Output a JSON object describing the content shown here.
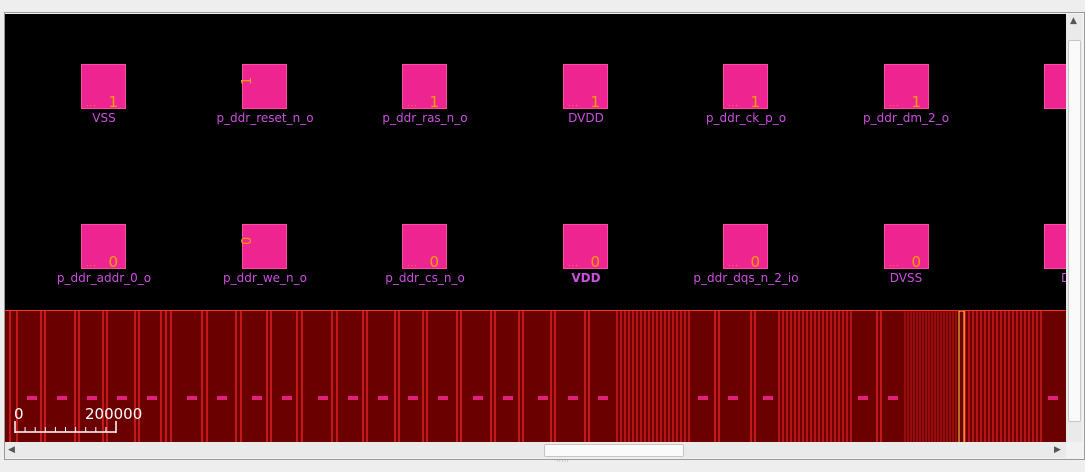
{
  "colors": {
    "background": "#000000",
    "pad_fill": "#ee2590",
    "pad_text": "#f4a000",
    "label_text": "#cc4fe0",
    "rail_fill": "#6b0000",
    "rail_lines": "#ff2a2a",
    "highlight_line": "#ffe040",
    "scale_text": "#ffffff"
  },
  "top_row": [
    {
      "label": "VSS",
      "number": "1",
      "dots": "... "
    },
    {
      "label": "p_ddr_reset_n_o",
      "number": "1",
      "rotated": true
    },
    {
      "label": "p_ddr_ras_n_o",
      "number": "1",
      "dots": "... "
    },
    {
      "label": "DVDD",
      "number": "1",
      "dots": "... "
    },
    {
      "label": "p_ddr_ck_p_o",
      "number": "1",
      "dots": "... "
    },
    {
      "label": "p_ddr_dm_2_o",
      "number": "1",
      "dots": "... "
    },
    {
      "label": "",
      "number": "",
      "dots": ""
    }
  ],
  "bottom_row": [
    {
      "label": "p_ddr_addr_0_o",
      "number": "0",
      "dots": "... "
    },
    {
      "label": "p_ddr_we_n_o",
      "number": "0",
      "rotated": true
    },
    {
      "label": "p_ddr_cs_n_o",
      "number": "0",
      "dots": "... "
    },
    {
      "label": "VDD",
      "number": "0",
      "dots": "... ",
      "bold": true
    },
    {
      "label": "p_ddr_dqs_n_2_io",
      "number": "0",
      "dots": "... "
    },
    {
      "label": "DVSS",
      "number": "0",
      "dots": "... "
    },
    {
      "label": "DV",
      "number": "",
      "dots": ""
    }
  ],
  "scale_bar": {
    "start": "0",
    "end": "200000"
  }
}
